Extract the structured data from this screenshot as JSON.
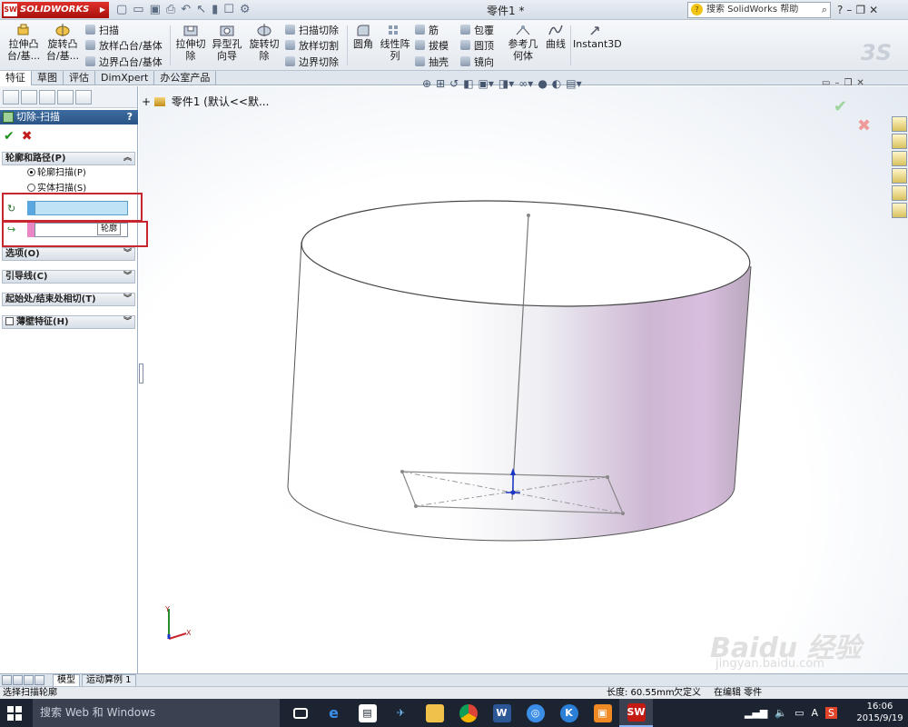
{
  "app": {
    "logo_text": "SOLIDWORKS",
    "logo_mark": "SW",
    "doc_title": "零件1 *",
    "help_search_placeholder": "搜索 SolidWorks 帮助"
  },
  "ribbon": {
    "extrude_boss": "拉伸凸\n台/基...",
    "revolve_boss": "旋转凸\n台/基...",
    "sweep": "扫描",
    "loft_boss": "放样凸台/基体",
    "boundary_boss": "边界凸台/基体",
    "extrude_cut": "拉伸切\n除",
    "hole_wizard": "异型孔\n向导",
    "revolve_cut": "旋转切\n除",
    "sweep_cut": "扫描切除",
    "loft_cut": "放样切割",
    "boundary_cut": "边界切除",
    "fillet": "圆角",
    "linear_pattern": "线性阵\n列",
    "rib": "筋",
    "draft": "拔模",
    "shell": "抽壳",
    "wrap": "包覆",
    "dome": "圆顶",
    "mirror": "镜向",
    "ref_geometry": "参考几\n何体",
    "curves": "曲线",
    "instant3d": "Instant3D"
  },
  "tabs": [
    {
      "label": "特征",
      "active": true
    },
    {
      "label": "草图",
      "active": false
    },
    {
      "label": "评估",
      "active": false
    },
    {
      "label": "DimXpert",
      "active": false
    },
    {
      "label": "办公室产品",
      "active": false
    }
  ],
  "property_manager": {
    "title": "切除-扫描",
    "help_mark": "?",
    "groups": {
      "profile_path": "轮廓和路径(P)",
      "options": "选项(O)",
      "guide_curves": "引导线(C)",
      "tangency": "起始处/结束处相切(T)",
      "thin_feature": "薄壁特征(H)"
    },
    "radio_profile_sweep": "轮廓扫描(P)",
    "radio_solid_sweep": "实体扫描(S)",
    "profile_tooltip": "轮廓"
  },
  "graphics": {
    "tree_root": "零件1 (默认<<默..."
  },
  "model_tabs": [
    "模型",
    "运动算例 1"
  ],
  "status": {
    "message": "选择扫描轮廓",
    "length": "长度: 60.55mm",
    "defined": "欠定义",
    "editing": "在编辑 零件"
  },
  "taskbar": {
    "search_placeholder": "搜索 Web 和 Windows",
    "ime": "A",
    "time": "16:06",
    "date": "2015/9/19"
  },
  "watermark": {
    "brand": "Baidu 经验",
    "url": "jingyan.baidu.com"
  },
  "colors": {
    "panel_header": "#2a5486",
    "profile_swatch": "#5aa7e0",
    "path_swatch": "#e887c4",
    "highlight_frame": "#c8262f",
    "accept": "#1d8f1d",
    "reject": "#c21b1b"
  }
}
